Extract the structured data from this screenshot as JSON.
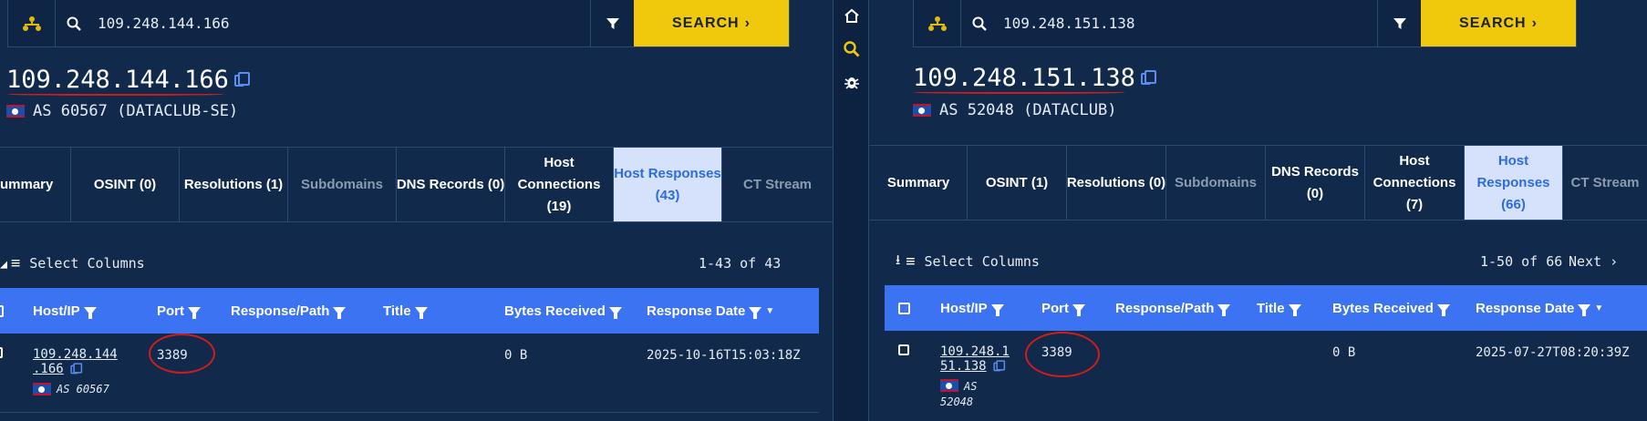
{
  "sidebar": {
    "icons": [
      "home-icon",
      "search-icon",
      "bug-icon"
    ]
  },
  "left": {
    "search": {
      "query": "109.248.144.166",
      "button": "SEARCH"
    },
    "host": {
      "ip": "109.248.144.166",
      "asn": "AS 60567 (DATACLUB-SE)"
    },
    "tabs": [
      {
        "label": "ummary"
      },
      {
        "label": "OSINT (0)"
      },
      {
        "label": "Resolutions (1)"
      },
      {
        "label": "Subdomains"
      },
      {
        "label": "DNS Records (0)"
      },
      {
        "label": "Host\nConnections\n(19)"
      },
      {
        "label": "Host Responses\n(43)"
      },
      {
        "label": "CT Stream"
      }
    ],
    "toolbar": {
      "select_columns": "Select Columns",
      "range": "1-43 of 43"
    },
    "columns": [
      "Host/IP",
      "Port",
      "Response/Path",
      "Title",
      "Bytes Received",
      "Response Date"
    ],
    "row": {
      "host_a": "109.248.144",
      "host_b": ".166",
      "asn": "AS 60567",
      "port": "3389",
      "bytes": "0 B",
      "date": "2025-10-16T15:03:18Z"
    }
  },
  "right": {
    "search": {
      "query": "109.248.151.138",
      "button": "SEARCH"
    },
    "host": {
      "ip": "109.248.151.138",
      "asn": "AS 52048 (DATACLUB)"
    },
    "tabs": [
      {
        "label": "Summary"
      },
      {
        "label": "OSINT (1)"
      },
      {
        "label": "Resolutions (0)"
      },
      {
        "label": "Subdomains"
      },
      {
        "label": "DNS Records\n(0)"
      },
      {
        "label": "Host\nConnections\n(7)"
      },
      {
        "label": "Host\nResponses\n(66)"
      },
      {
        "label": "CT Stream"
      }
    ],
    "toolbar": {
      "select_columns": "Select Columns",
      "range": "1-50 of 66",
      "next": "Next"
    },
    "columns": [
      "Host/IP",
      "Port",
      "Response/Path",
      "Title",
      "Bytes Received",
      "Response Date"
    ],
    "row": {
      "host_a": "109.248.1",
      "host_b": "51.138",
      "asn_a": "AS",
      "asn_b": "52048",
      "port": "3389",
      "bytes": "0 B",
      "date": "2025-07-27T08:20:39Z"
    }
  }
}
